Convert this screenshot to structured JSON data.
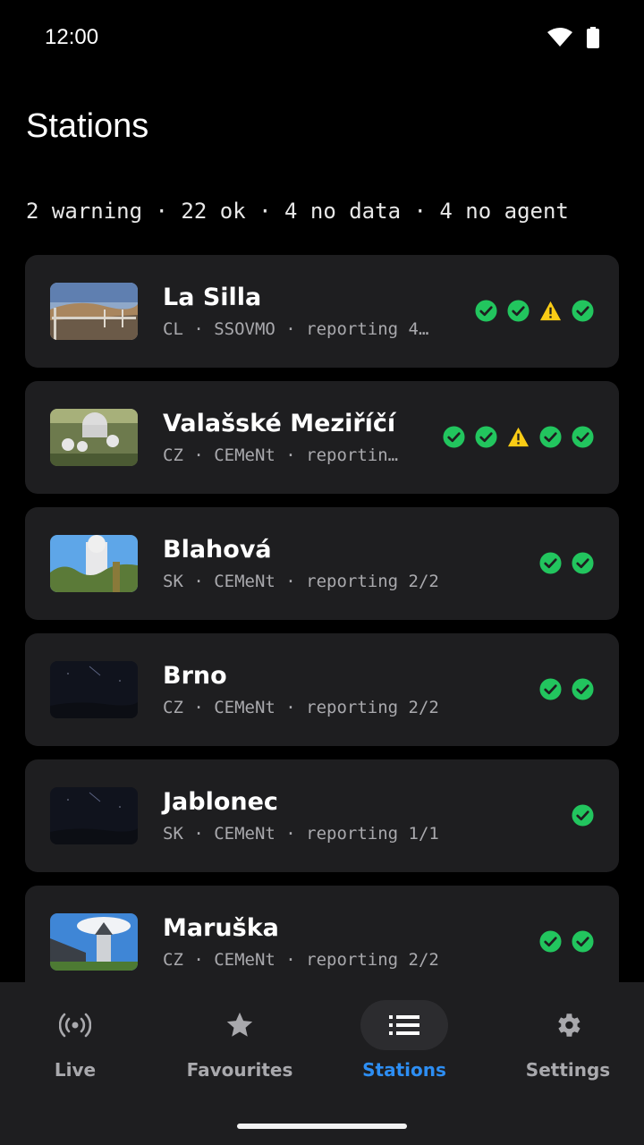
{
  "status_bar": {
    "time": "12:00",
    "wifi_icon": "wifi-icon",
    "battery_icon": "battery-icon"
  },
  "page": {
    "title": "Stations",
    "summary": "2 warning · 22 ok · 4 no data · 4 no agent"
  },
  "colors": {
    "ok": "#22c55e",
    "warning": "#facc15",
    "accent": "#2d8ef3",
    "card": "#1e1e20"
  },
  "stations": [
    {
      "name": "La Silla",
      "subtitle": "CL · SSOVMO · reporting 4…",
      "thumb": "mountain-deck",
      "statuses": [
        "ok",
        "ok",
        "warning",
        "ok"
      ]
    },
    {
      "name": "Valašské Meziříčí",
      "subtitle": "CZ · CEMeNt · reportin…",
      "thumb": "observatory-domes",
      "statuses": [
        "ok",
        "ok",
        "warning",
        "ok",
        "ok"
      ]
    },
    {
      "name": "Blahová",
      "subtitle": "SK · CEMeNt · reporting 2/2",
      "thumb": "tower-sky",
      "statuses": [
        "ok",
        "ok"
      ]
    },
    {
      "name": "Brno",
      "subtitle": "CZ · CEMeNt · reporting 2/2",
      "thumb": "night-sky",
      "statuses": [
        "ok",
        "ok"
      ]
    },
    {
      "name": "Jablonec",
      "subtitle": "SK · CEMeNt · reporting 1/1",
      "thumb": "night-sky",
      "statuses": [
        "ok"
      ]
    },
    {
      "name": "Maruška",
      "subtitle": "CZ · CEMeNt · reporting 2/2",
      "thumb": "church-sky",
      "statuses": [
        "ok",
        "ok"
      ]
    }
  ],
  "nav": [
    {
      "label": "Live",
      "icon": "broadcast-icon",
      "active": false
    },
    {
      "label": "Favourites",
      "icon": "star-icon",
      "active": false
    },
    {
      "label": "Stations",
      "icon": "list-icon",
      "active": true
    },
    {
      "label": "Settings",
      "icon": "gear-icon",
      "active": false
    }
  ]
}
